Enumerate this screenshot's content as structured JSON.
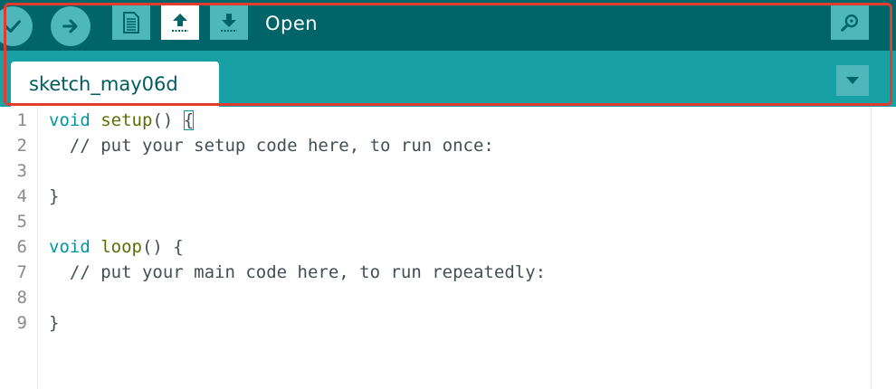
{
  "toolbar": {
    "buttons": [
      {
        "name": "verify",
        "icon": "checkmark-icon"
      },
      {
        "name": "upload",
        "icon": "arrow-right-icon"
      },
      {
        "name": "new",
        "icon": "new-file-icon"
      },
      {
        "name": "open",
        "icon": "arrow-up-icon"
      },
      {
        "name": "save",
        "icon": "arrow-down-icon"
      }
    ],
    "hover_label": "Open",
    "serial_monitor_icon": "magnifier-icon"
  },
  "tabs": [
    {
      "label": "sketch_may06d",
      "active": true
    }
  ],
  "tab_menu_icon": "triangle-down-icon",
  "editor": {
    "lines": [
      {
        "num": "1",
        "keyword": "void",
        "func": "setup",
        "rest": "() ",
        "brace": "{"
      },
      {
        "num": "2",
        "comment": "  // put your setup code here, to run once:"
      },
      {
        "num": "3",
        "text": ""
      },
      {
        "num": "4",
        "text": "}"
      },
      {
        "num": "5",
        "text": ""
      },
      {
        "num": "6",
        "keyword": "void",
        "func": "loop",
        "rest": "() {"
      },
      {
        "num": "7",
        "comment": "  // put your main code here, to run repeatedly:"
      },
      {
        "num": "8",
        "text": ""
      },
      {
        "num": "9",
        "text": "}"
      }
    ]
  },
  "colors": {
    "toolbar": "#006468",
    "tabbar": "#17a1a5",
    "button": "#4db7bb",
    "highlight": "#e23b30",
    "keyword": "#00979c",
    "function": "#5e6d03"
  }
}
